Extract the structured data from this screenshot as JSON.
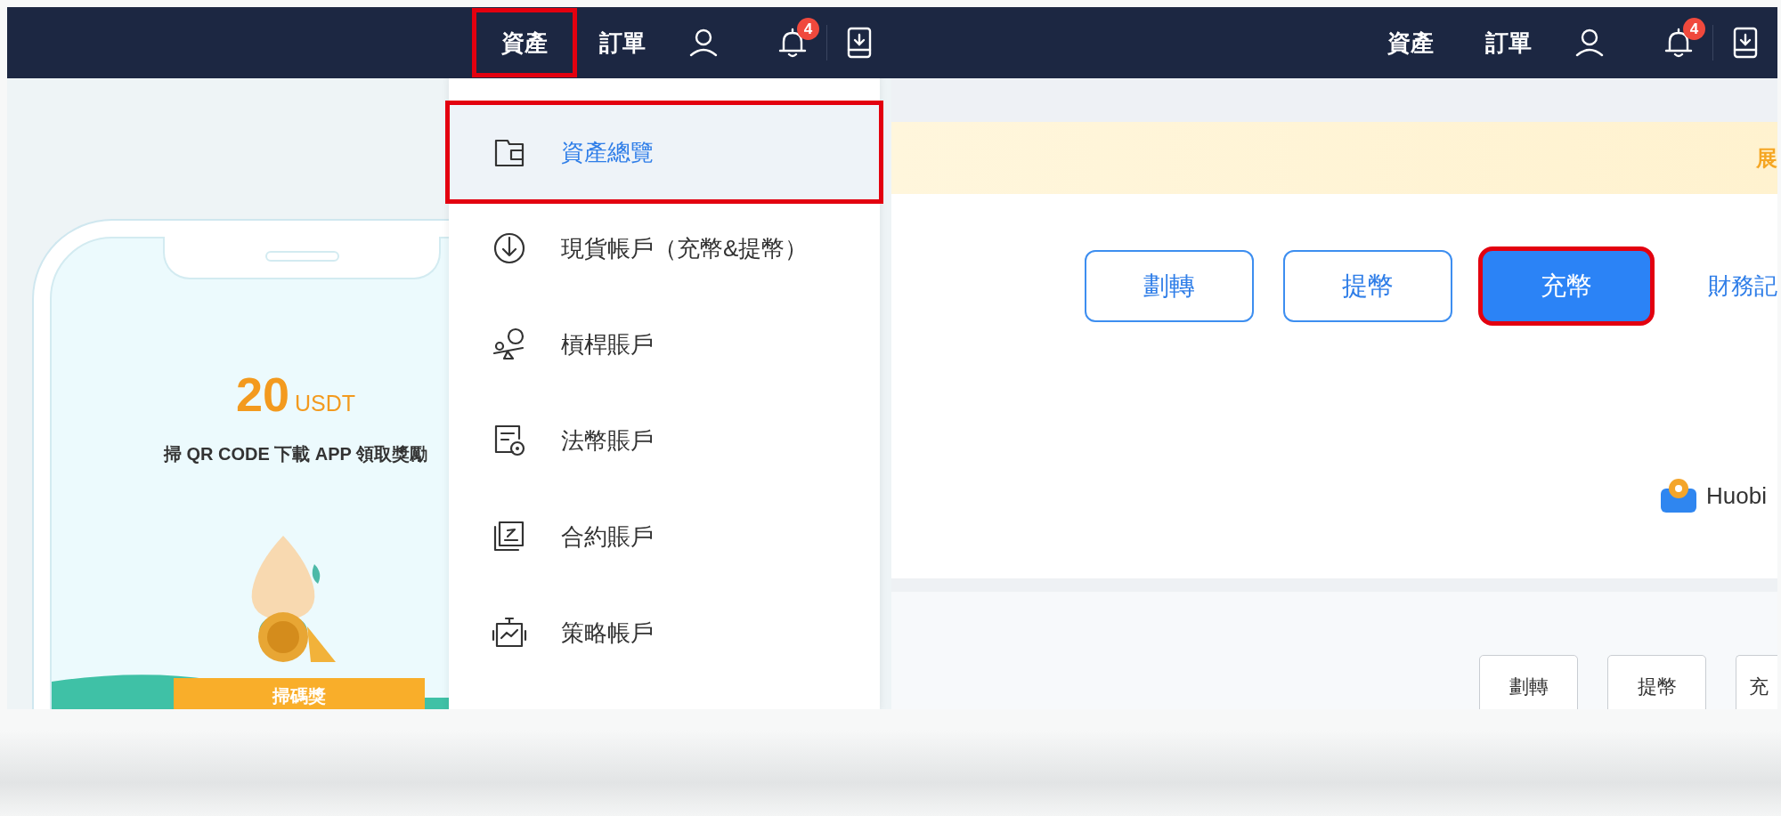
{
  "left_panel": {
    "nav": {
      "items": [
        {
          "kind": "text",
          "label": "資產",
          "annotated": true
        },
        {
          "kind": "text",
          "label": "訂單",
          "annotated": false
        },
        {
          "kind": "user"
        },
        {
          "kind": "bell",
          "badge": "4"
        },
        {
          "kind": "download"
        }
      ]
    },
    "promo": {
      "amount": "20",
      "unit": "USDT",
      "caption": "掃 QR CODE 下載 APP 領取獎勵",
      "ribbon": "掃碼獎"
    },
    "menu": {
      "items": [
        {
          "kind": "wallet",
          "label": "資產總覽",
          "selected": true,
          "annotated": true
        },
        {
          "kind": "deposit",
          "label": "現貨帳戶（充幣&提幣）",
          "selected": false,
          "annotated": false
        },
        {
          "kind": "leverage",
          "label": "槓桿賬戶",
          "selected": false,
          "annotated": false
        },
        {
          "kind": "fiat",
          "label": "法幣賬戶",
          "selected": false,
          "annotated": false
        },
        {
          "kind": "contract",
          "label": "合約賬戶",
          "selected": false,
          "annotated": false
        },
        {
          "kind": "strategy",
          "label": "策略帳戶",
          "selected": false,
          "annotated": false
        }
      ]
    }
  },
  "right_panel": {
    "nav": {
      "items": [
        {
          "kind": "text",
          "label": "資產",
          "annotated": false
        },
        {
          "kind": "text",
          "label": "訂單",
          "annotated": false
        },
        {
          "kind": "user"
        },
        {
          "kind": "bell",
          "badge": "4"
        },
        {
          "kind": "download"
        }
      ]
    },
    "banner": {
      "text": "展"
    },
    "actions": [
      {
        "kind": "outline",
        "label": "劃轉",
        "annotated": false
      },
      {
        "kind": "outline",
        "label": "提幣",
        "annotated": false
      },
      {
        "kind": "primary",
        "label": "充幣",
        "annotated": true
      },
      {
        "kind": "link",
        "label": "財務記",
        "annotated": false
      }
    ],
    "account": {
      "name": "Huobi"
    },
    "sub_actions": [
      {
        "label": "劃轉"
      },
      {
        "label": "提幣"
      },
      {
        "label": "充"
      }
    ]
  }
}
